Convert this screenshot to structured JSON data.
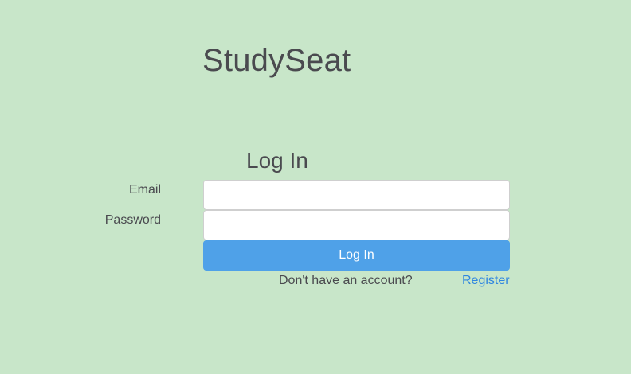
{
  "app": {
    "title": "StudySeat"
  },
  "login_form": {
    "heading": "Log In",
    "email_label": "Email",
    "email_value": "",
    "email_placeholder": "",
    "password_label": "Password",
    "password_value": "",
    "password_placeholder": "",
    "submit_label": "Log In",
    "register_prompt": "Don't have an account?",
    "register_link": "Register"
  },
  "colors": {
    "background": "#c8e6c9",
    "button": "#4fa1e8",
    "link": "#2f86e0",
    "text": "#4a4a4f"
  }
}
